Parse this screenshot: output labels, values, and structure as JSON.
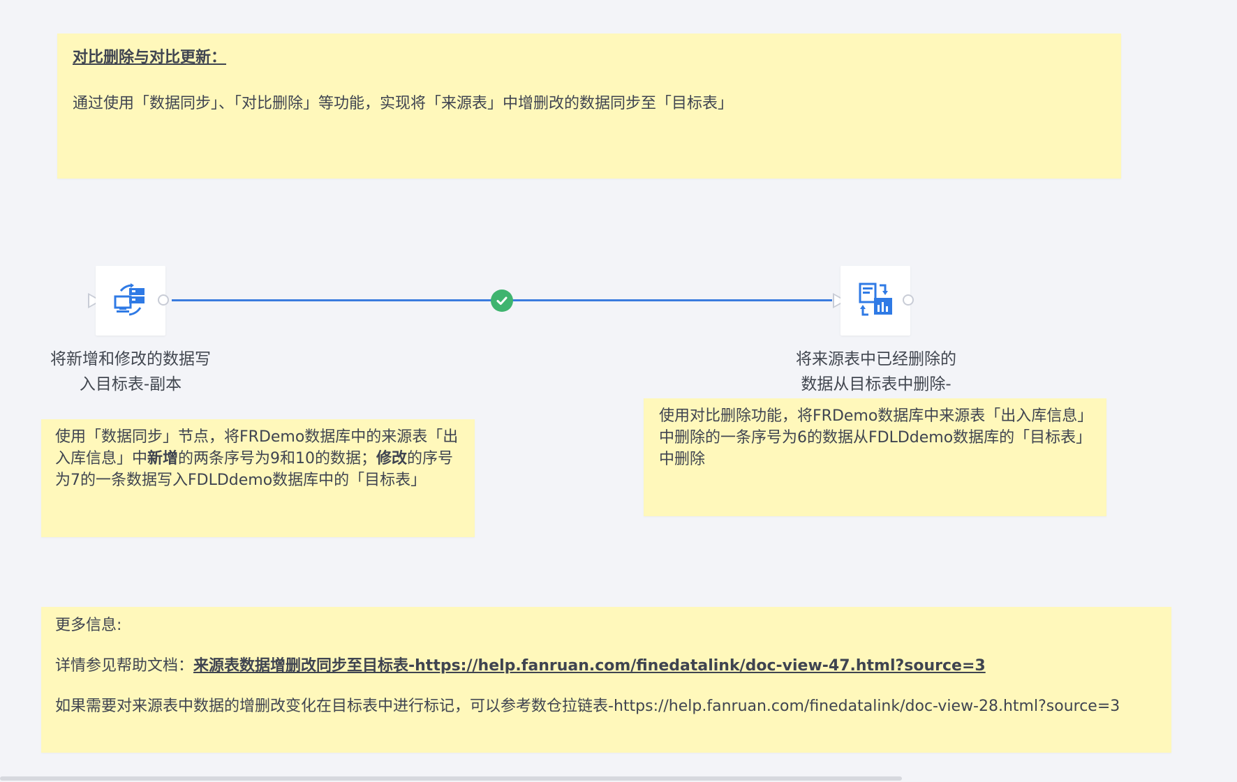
{
  "notes": {
    "top": {
      "title": "对比删除与对比更新：",
      "body": "通过使用「数据同步」、「对比删除」等功能，实现将「来源表」中增删改的数据同步至「目标表」"
    },
    "left": {
      "p1": "使用「数据同步」节点，将FRDemo数据库中的来源表「出入库信息」中",
      "b1": "新增",
      "p2": "的两条序号为9和10的数据；",
      "b2": "修改",
      "p3": "的序号为7的一条数据写入FDLDdemo数据库中的「目标表」"
    },
    "right": {
      "text": "使用对比删除功能，将FRDemo数据库中来源表「出入库信息」中删除的一条序号为6的数据从FDLDdemo数据库的「目标表」中删除"
    },
    "bottom": {
      "heading": "更多信息:",
      "help_prefix": "详情参见帮助文档：",
      "help_link": "来源表数据增删改同步至目标表-https://help.fanruan.com/finedatalink/doc-view-47.html?source=3",
      "extra": "如果需要对来源表中数据的增删改变化在目标表中进行标记，可以参考数仓拉链表-https://help.fanruan.com/finedatalink/doc-view-28.html?source=3"
    }
  },
  "nodes": {
    "left": {
      "label_line1": "将新增和修改的数据写",
      "label_line2": "入目标表-副本",
      "icon": "data-sync-icon"
    },
    "right": {
      "label_line1": "将来源表中已经删除的",
      "label_line2": "数据从目标表中删除-",
      "icon": "compare-delete-icon"
    }
  },
  "link": {
    "status": "success",
    "status_icon": "check-circle-icon",
    "color": "#3a7bde",
    "ok_color": "#3fb46f"
  },
  "colors": {
    "note_bg": "#fff8bb",
    "canvas_bg": "#f3f4f8",
    "icon_blue": "#2f7ae5"
  }
}
